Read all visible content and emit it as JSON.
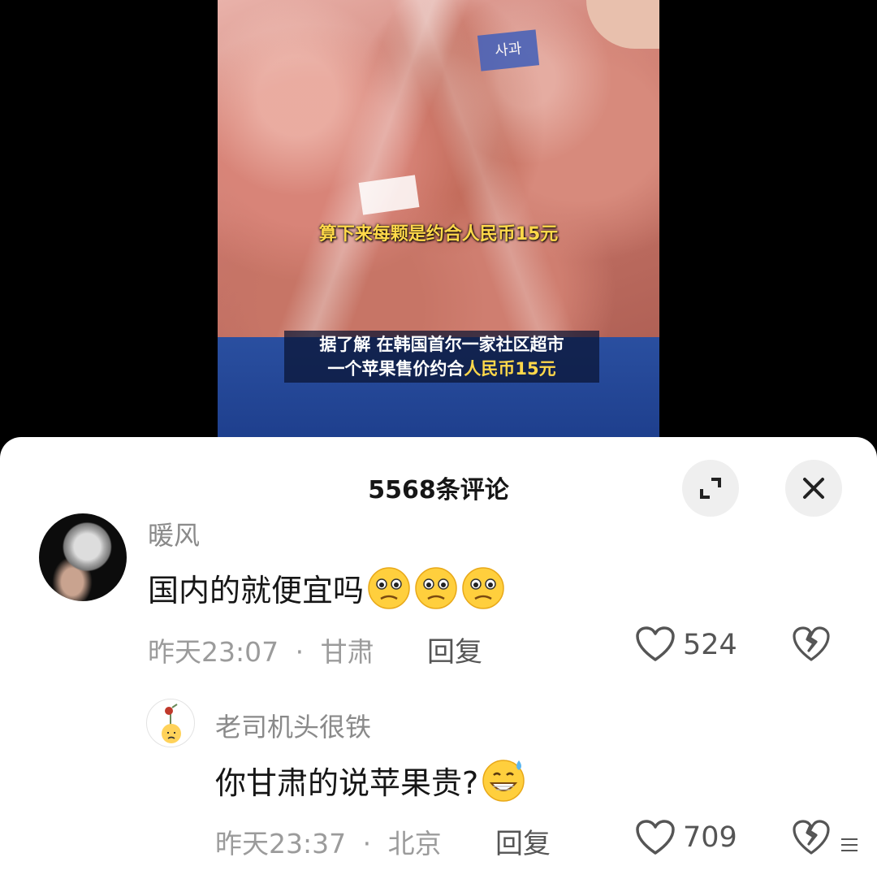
{
  "video": {
    "caption_mid": "算下来每颗是约合人民币15元",
    "caption_line1": "据了解 在韩国首尔一家社区超市",
    "caption_line2_prefix": "一个苹果售价约合",
    "caption_line2_highlight": "人民币15元",
    "brand_label": "사과",
    "highlight_color": "#ffd84a"
  },
  "sheet": {
    "title": "5568条评论",
    "expand_icon": "expand-icon",
    "close_icon": "close-icon"
  },
  "comments": [
    {
      "username": "暖风",
      "text": "国内的就便宜吗",
      "emoji": [
        "unamused-face-icon",
        "unamused-face-icon",
        "unamused-face-icon"
      ],
      "time": "昨天23:07",
      "location": "甘肃",
      "reply_label": "回复",
      "likes": "524"
    },
    {
      "username": "老司机头很铁",
      "text": "你甘肃的说苹果贵?",
      "emoji": [
        "grinning-sweat-icon"
      ],
      "time": "昨天23:37",
      "location": "北京",
      "reply_label": "回复",
      "likes": "709"
    }
  ],
  "meta_separator": "·"
}
